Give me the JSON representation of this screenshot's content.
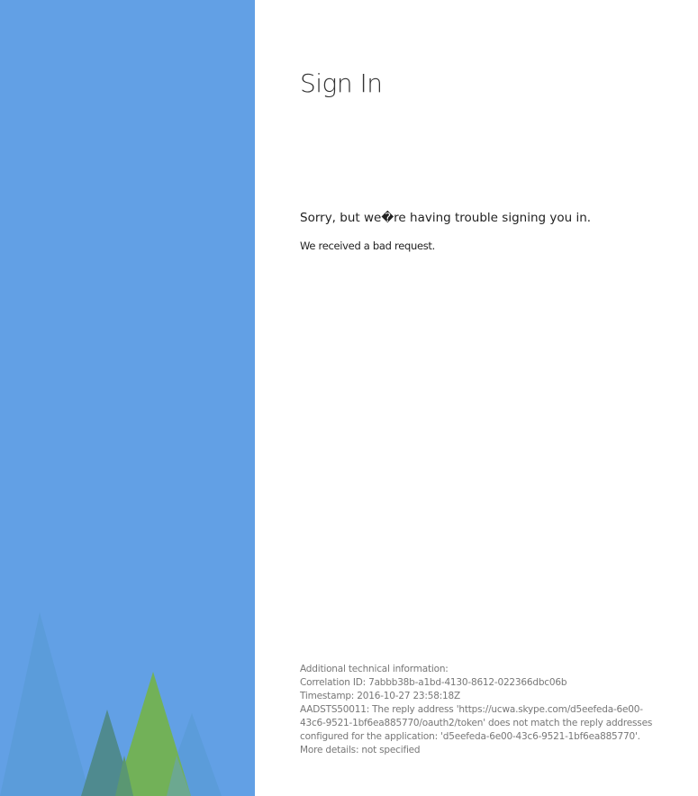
{
  "page": {
    "title": "Sign In"
  },
  "error": {
    "heading": "Sorry, but we�re having trouble signing you in.",
    "detail": "We received a bad request."
  },
  "technical_info": {
    "header": "Additional technical information:",
    "correlation_id": "Correlation ID: 7abbb38b-a1bd-4130-8612-022366dbc06b",
    "timestamp": "Timestamp: 2016-10-27 23:58:18Z",
    "message": "AADSTS50011: The reply address 'https://ucwa.skype.com/d5eefeda-6e00-43c6-9521-1bf6ea885770/oauth2/token' does not match the reply addresses configured for the application: 'd5eefeda-6e00-43c6-9521-1bf6ea885770'. More details: not specified"
  },
  "colors": {
    "side_panel": "#62a0e5",
    "tree_green": "#72b158",
    "tree_teal": "#4f8a8f",
    "tree_light": "#5b9bd8"
  },
  "icons": {
    "illustration": "pine-trees-illustration"
  }
}
